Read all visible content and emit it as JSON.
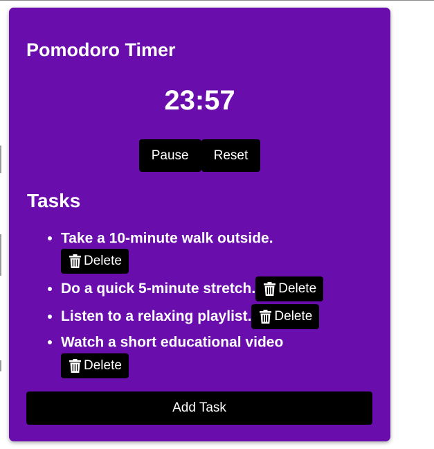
{
  "app": {
    "title": "Pomodoro Timer",
    "accent_color": "#6a0dad",
    "button_color": "#000000"
  },
  "timer": {
    "display": "23:57"
  },
  "controls": {
    "pause_label": "Pause",
    "reset_label": "Reset"
  },
  "tasks": {
    "heading": "Tasks",
    "items": [
      {
        "text": "Take a 10-minute walk outside.",
        "delete_label": "Delete",
        "icon": "trash-icon"
      },
      {
        "text": "Do a quick 5-minute stretch.",
        "delete_label": "Delete",
        "icon": "trash-icon"
      },
      {
        "text": "Listen to a relaxing playlist.",
        "delete_label": "Delete",
        "icon": "trash-icon"
      },
      {
        "text": "Watch a short educational video",
        "delete_label": "Delete",
        "icon": "trash-icon"
      }
    ],
    "add_label": "Add Task"
  }
}
